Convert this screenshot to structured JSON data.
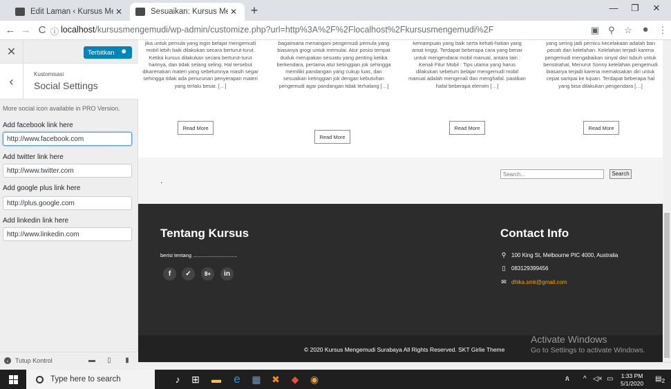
{
  "browser": {
    "tabs": [
      {
        "title": "Edit Laman ‹ Kursus Mengemudi",
        "active": false
      },
      {
        "title": "Sesuaikan: Kursus Mengemudi S",
        "active": true
      }
    ],
    "url_host": "localhost",
    "url_path": "/kursusmengemudi/wp-admin/customize.php?url=http%3A%2F%2Flocalhost%2Fkursusmengemudi%2F"
  },
  "sidebar": {
    "publish_label": "Terbitkan",
    "breadcrumb": "Kustomisasi",
    "section_title": "Social Settings",
    "note": "More social icon available in PRO Version.",
    "fields": [
      {
        "label": "Add facebook link here",
        "value": "http://www.facebook.com"
      },
      {
        "label": "Add twitter link here",
        "value": "http://www.twitter.com"
      },
      {
        "label": "Add google plus link here",
        "value": "http://plus.google.com"
      },
      {
        "label": "Add linkedin link here",
        "value": "http://www.linkedin.com"
      }
    ],
    "hide_controls": "Tutup Kontrol"
  },
  "preview": {
    "posts": [
      {
        "excerpt": "jika untuk pemula yang ingin belajar mengemudi mobil lebih baik dilakukan secara berturut-turut. Ketika kursus dilakukan secara berturut-turut harinya, dan tidak selang seling. Hal tersebut dikarenakan materi yang sebelumnya masih segar sehingga tidak ada penurunan penyerapan materi yang terlalu besar. […]",
        "read_more": "Read More"
      },
      {
        "excerpt": "bagaimana menangani pengemudi pemula yang biasanya grogi untuk memulai. Atur posisi tempat duduk merupakan sesuatu yang penting ketika berkendara, pertama atur ketinggian jok sehingga memiliki pandangan yang cukup luas, dan sesuaikan ketinggian jok dengan kebutuhan pengemudi agar pandangan tidak terhalang […]",
        "read_more": "Read More"
      },
      {
        "excerpt": "kemampuan yang baik serta kehati-hatian yang amat tinggi. Terdapat beberapa cara yang benar untuk mengendarai mobil manual, antara lain : Kenali Fitur Mobil : Tips utama yang harus dilakukan sebelum belajar mengemudi mobil manual adalah mengenali dan menghafal. pastikan hafal beberapa elemen […]",
        "read_more": "Read More"
      },
      {
        "excerpt": "yang sering jadi pemicu kecelakaan adalah ban pecah dan kelelahan. Kelelahan terjadi karena pengemudi mengabaikan sinyal dari tubuh untuk beristirahat, Menurut Sonny kelelahan pengemudi biasanya terjadi karena memaksakan diri untuk cepat sampai ke tujuan. Terdapat beberapa hal yang bisa dilakukan pengendara […]",
        "read_more": "Read More"
      }
    ],
    "widget_dot": ".",
    "search_placeholder": "Search...",
    "search_button": "Search",
    "footer": {
      "about_title": "Tentang Kursus",
      "about_text": "berisi tentang ...............................",
      "social_icons": [
        "f",
        "✓",
        "8+",
        "in"
      ],
      "contact_title": "Contact Info",
      "address": "100 King St, Melbourne PIC 4000, Australia",
      "phone": "083129399456",
      "email": "dhika.smk@gmail.com",
      "copyright": "© 2020 Kursus Mengemudi Surabaya  All Rights Reserved. SKT Girlie Theme"
    },
    "watermark_line1": "Activate Windows",
    "watermark_line2": "Go to Settings to activate Windows."
  },
  "taskbar": {
    "search_placeholder": "Type here to search",
    "time": "1:33 PM",
    "date": "5/1/2020",
    "notification_count": "2"
  }
}
